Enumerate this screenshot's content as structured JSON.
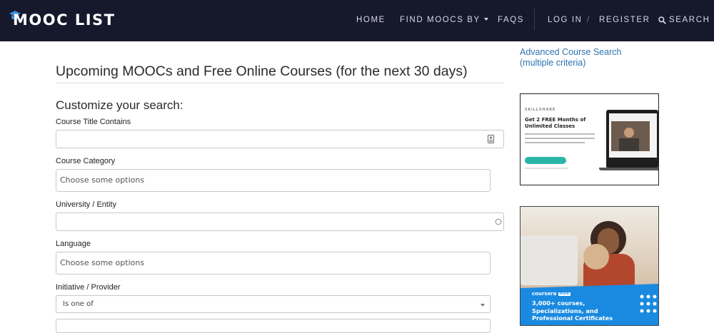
{
  "header": {
    "logo_text": "MOOC LIST",
    "nav": {
      "home": "HOME",
      "find_moocs": "FIND MOOCS BY",
      "faqs": "FAQS",
      "login": "LOG IN",
      "separator": "/",
      "register": "REGISTER",
      "search": "SEARCH"
    }
  },
  "main": {
    "page_title": "Upcoming MOOCs and Free Online Courses (for the next 30 days)",
    "customize_heading": "Customize your search:",
    "fields": {
      "course_title": {
        "label": "Course Title Contains",
        "value": ""
      },
      "course_category": {
        "label": "Course Category",
        "placeholder": "Choose some options"
      },
      "university": {
        "label": "University / Entity",
        "value": ""
      },
      "language": {
        "label": "Language",
        "placeholder": "Choose some options"
      },
      "initiative": {
        "label": "Initiative / Provider",
        "selected": "Is one of"
      }
    }
  },
  "sidebar": {
    "advanced_search_link": "Advanced Course Search (multiple criteria)",
    "ad_skillshare": {
      "brand": "SKILLSHARE",
      "headline": "Get 2 FREE Months of Unlimited Classes"
    },
    "ad_coursera": {
      "brand": "coursera",
      "badge": "PLUS",
      "headline": "3,000+ courses, Specializations, and Professional Certificates"
    }
  },
  "colors": {
    "header_bg": "#16182b",
    "link": "#2c72b0",
    "logo_accent": "#3a8fd8",
    "coursera_blue": "#1a8ae0",
    "skillshare_teal": "#2bb5a8"
  }
}
